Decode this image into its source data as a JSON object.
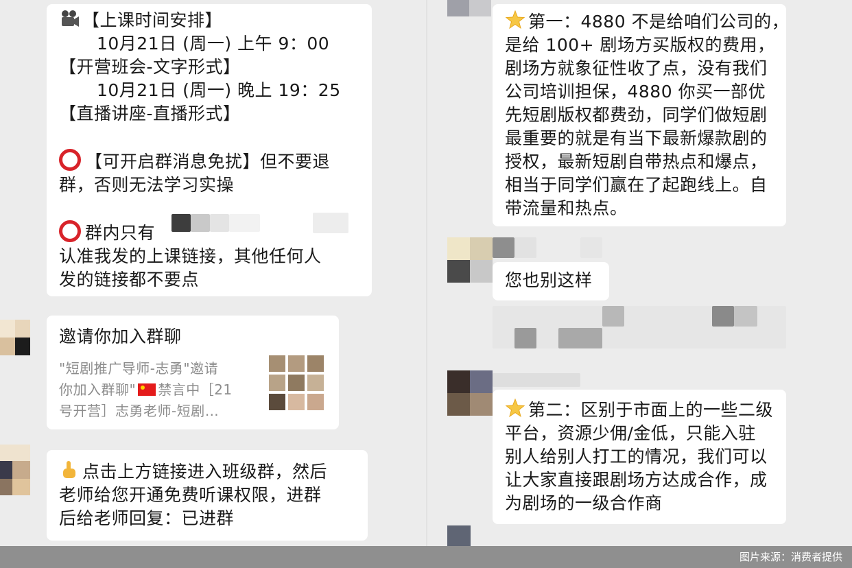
{
  "left_column": {
    "schedule_message": {
      "line1": "【上课时间安排】",
      "line2": "10月21日 (周一) 上午 9：00",
      "line3": "【开营班会-文字形式】",
      "line4": "10月21日 (周一) 晚上 19：25",
      "line5": "【直播讲座-直播形式】",
      "line6": "【可开启群消息免扰】但不要退",
      "line7": "群，否则无法学习实操",
      "line8": "群内只有",
      "line9": "认准我发的上课链接，其他任何人",
      "line10": "发的链接都不要点"
    },
    "invite_card": {
      "title": "邀请你加入群聊",
      "desc_line1": "\"短剧推广导师-志勇\"邀请",
      "desc_line2_a": "你加入群聊\"",
      "desc_line2_b": "禁言中［21",
      "desc_line3": "号开营］志勇老师-短剧…"
    },
    "instruction_message": {
      "line1": "点击上方链接进入班级群，然后",
      "line2": "老师给您开通免费听课权限，进群",
      "line3": "后给老师回复：已进群"
    }
  },
  "right_column": {
    "message_one": {
      "line1": "第一：4880 不是给咱们公司的，",
      "line2": "是给 100+ 剧场方买版权的费用，",
      "line3": "剧场方就象征性收了点，没有我们",
      "line4": "公司培训担保，4880 你买一部优",
      "line5": "先短剧版权都费劲，同学们做短剧",
      "line6": "最重要的就是有当下最新爆款剧的",
      "line7": "授权，最新短剧自带热点和爆点，",
      "line8": "相当于同学们赢在了起跑线上。自",
      "line9": "带流量和热点。"
    },
    "short_reply": "您也别这样",
    "message_two": {
      "line1": "第二：区别于市面上的一些二级",
      "line2": "平台，资源少佣/金低，只能入驻",
      "line3": "别人给别人打工的情况，我们可以",
      "line4": "让大家直接跟剧场方达成合作，成",
      "line5": "为剧场的一级合作商"
    }
  },
  "footer": {
    "credit": "图片来源：消费者提供"
  },
  "icons": {
    "camera": "movie-camera-icon",
    "ring": "red-circle-icon",
    "star": "glowing-star-icon",
    "pointing_hand": "pointing-up-hand-icon",
    "flag": "china-flag-icon"
  },
  "colors": {
    "background": "#ececec",
    "bubble": "#ffffff",
    "ring_red": "#d8232a",
    "muted_text": "#8c8c8c",
    "footer_bar": "#8f8f8f"
  }
}
